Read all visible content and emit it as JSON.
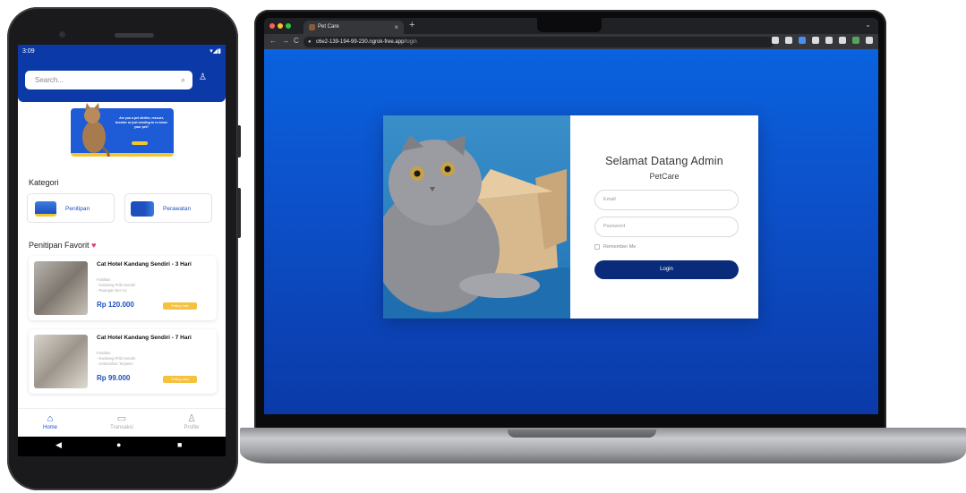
{
  "laptop": {
    "browser": {
      "tab_title": "Pet Care",
      "tab_close": "×",
      "new_tab": "+",
      "tab_menu": "⌄",
      "back": "←",
      "forward": "→",
      "reload": "C",
      "url_host": "c6e2-139-194-99-230.ngrok-free.app",
      "url_path": "/login"
    },
    "login": {
      "welcome": "Selamat Datang Admin",
      "brand": "PetCare",
      "email_placeholder": "Email",
      "password_placeholder": "Password",
      "remember_label": "Remember Me",
      "login_button": "Login"
    }
  },
  "phone": {
    "status": {
      "time": "3:09",
      "icons": "▾◢▮"
    },
    "search_placeholder": "Search...",
    "banner_title": "Are you a pet shelter, rescuer, breeder or just needing to re-home your pet?",
    "kategori_title": "Kategori",
    "categories": [
      {
        "label": "Penitipan"
      },
      {
        "label": "Perawatan"
      }
    ],
    "favorit_title": "Penitipan Favorit",
    "favorites": [
      {
        "title": "Cat Hotel Kandang Sendiri - 3 Hari",
        "facilities": [
          "Fasilitas",
          "- Kandang Pribi Sendiri",
          "- Ruangan Ber AC"
        ],
        "price": "Rp 120.000",
        "badge": "Paling Laris"
      },
      {
        "title": "Cat Hotel Kandang Sendiri - 7 Hari",
        "facilities": [
          "Fasilitas",
          "- Kandang Pribi Sendiri",
          "- Kebersihan Terjamin"
        ],
        "price": "Rp 99.000",
        "badge": "Paling Laris"
      }
    ],
    "bottom_nav": [
      {
        "label": "Home",
        "icon": "home-icon",
        "active": true
      },
      {
        "label": "Transaksi",
        "icon": "chart-icon",
        "active": false
      },
      {
        "label": "Profile",
        "icon": "user-icon",
        "active": false
      }
    ]
  },
  "colors": {
    "primary_blue": "#0b3aa8",
    "login_button": "#0a2a7a",
    "accent_yellow": "#f6c23e",
    "heart": "#e8336e"
  }
}
